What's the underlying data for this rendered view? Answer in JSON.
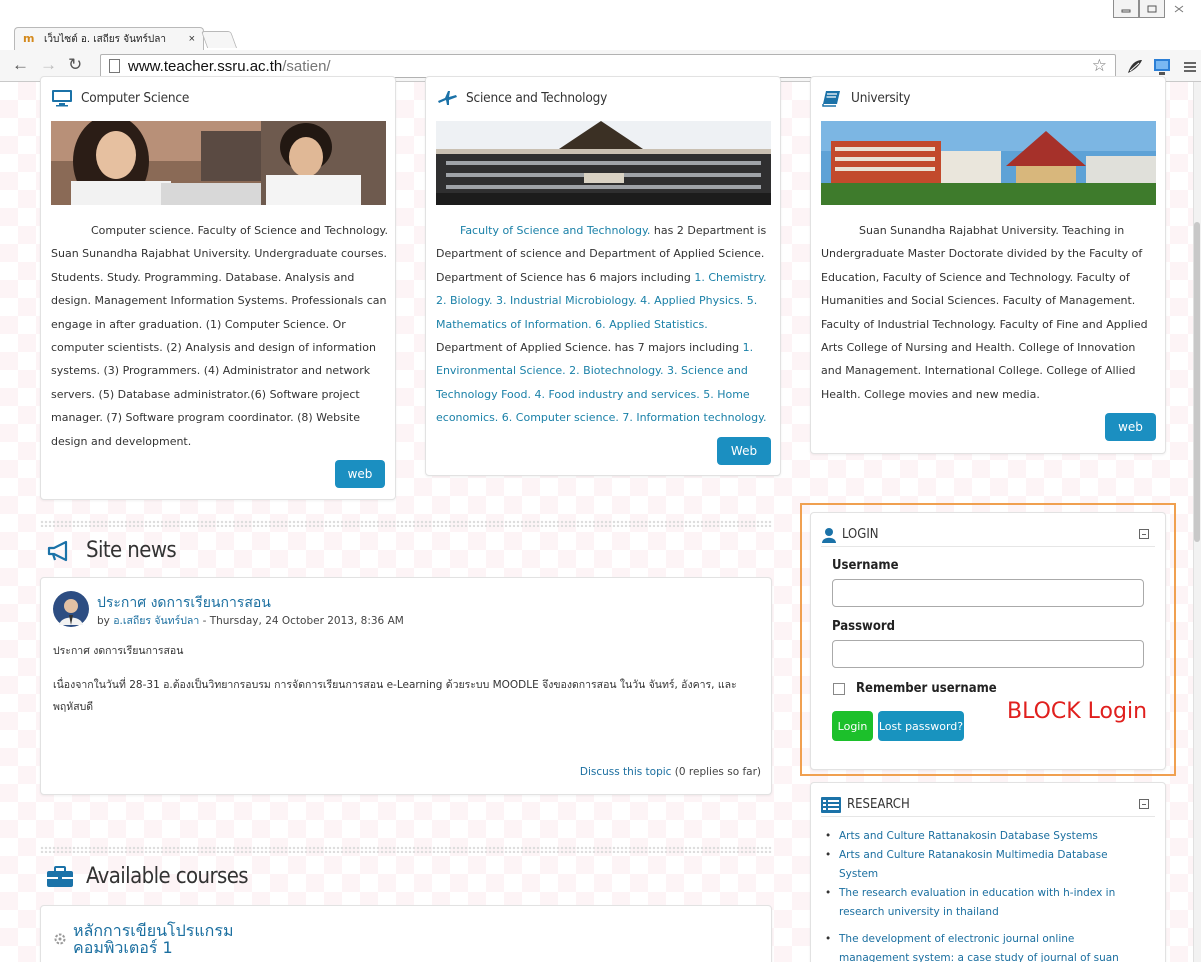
{
  "browser": {
    "tab_title": "เว็บไซต์ อ. เสถียร จันทร์ปลา",
    "tab_close": "×",
    "url_host": "www.teacher.ssru.ac.th",
    "url_path": "/satien/"
  },
  "cards": {
    "computer_science": {
      "title": "Computer Science",
      "text": "Computer science. Faculty of Science and Technology. Suan Sunandha Rajabhat University. Undergraduate courses. Students. Study. Programming. Database. Analysis and design. Management Information Systems. Professionals can engage in after graduation. (1) Computer Science. Or computer scientists. (2) Analysis and design of information systems. (3) Programmers. (4) Administrator and network servers. (5) Database administrator.(6) Software project manager. (7) Software program coordinator. (8) Website design and development.",
      "button": "web"
    },
    "science_tech": {
      "title": "Science and Technology",
      "link_faculty": "Faculty of Science and Technology.",
      "text_a": " has 2 Department is Department of science and Department of Applied Science. Department of Science has 6  majors including ",
      "link_majors_a": "1. Chemistry. 2. Biology. 3. Industrial Microbiology. 4. Applied Physics. 5. Mathematics of Information. 6. Applied Statistics.",
      "text_b": "  Department of Applied Science. has 7 majors including  ",
      "link_majors_b": "1. Environmental Science. 2. Biotechnology.  3. Science and Technology Food. 4. Food industry and services. 5. Home economics.  6. Computer science.  7. Information technology.",
      "button": "Web"
    },
    "university": {
      "title": "University",
      "text": "Suan Sunandha Rajabhat University. Teaching in Undergraduate Master Doctorate divided by the Faculty of Education, Faculty of Science and Technology. Faculty of Humanities and Social Sciences. Faculty of Management. Faculty of Industrial Technology. Faculty of Fine and Applied Arts College of Nursing and Health. College of Innovation and Management. International College. College of Allied Health. College movies and new media.",
      "button": "web"
    }
  },
  "site_news": {
    "heading": "Site news",
    "post_title": "ประกาศ งดการเรียนการสอน",
    "meta_by": "by ",
    "meta_author": "อ.เสถียร จันทร์ปลา",
    "meta_date": " - Thursday, 24 October 2013, 8:36 AM",
    "body_line1": "ประกาศ งดการเรียนการสอน",
    "body_line2": "เนื่องจากในวันที่ 28-31 อ.ต้องเป็นวิทยากรอบรม การจัดการเรียนการสอน e-Learning ด้วยระบบ MOODLE จึงของดการสอน ในวัน จันทร์, อังคาร, และพฤหัสบดี",
    "discuss_link": "Discuss this topic",
    "replies": " (0 replies so far)"
  },
  "courses": {
    "heading": "Available courses",
    "course1": "หลักการเขียนโปรแกรม คอมพิวเตอร์ 1"
  },
  "login": {
    "title": "LOGIN",
    "username_label": "Username",
    "password_label": "Password",
    "remember": "Remember username",
    "login_button": "Login",
    "lost_button": "Lost password?",
    "annotation": "BLOCK Login"
  },
  "research": {
    "title": "RESEARCH",
    "items": [
      "Arts and Culture Rattanakosin Database Systems",
      "Arts and Culture Ratanakosin Multimedia Database System",
      "The research evaluation in education with h-index in research university in thailand",
      "The development of electronic journal online management system: a case study of journal of suan"
    ]
  },
  "colors": {
    "accent_blue": "#1b8fc1",
    "login_green": "#1cc02b",
    "annotation_orange": "#f0a050",
    "annotation_red": "#e0201e"
  }
}
